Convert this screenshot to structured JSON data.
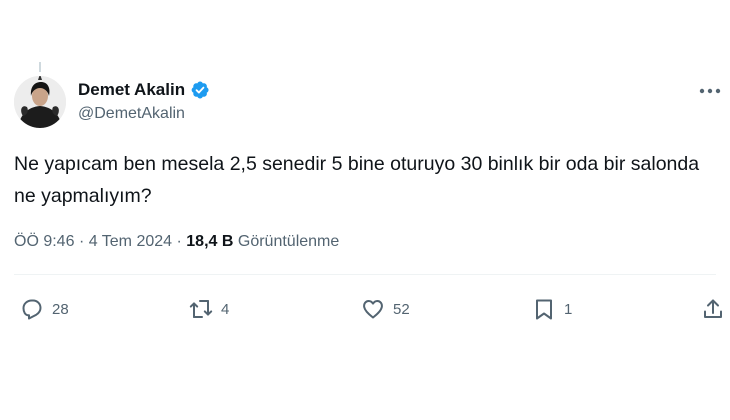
{
  "author": {
    "display_name": "Demet Akalin",
    "handle": "@DemetAkalin",
    "verified": true
  },
  "tweet": {
    "text": "Ne yapıcam ben mesela 2,5 senedir 5 bine oturuyo 30 binlık bir oda bir salonda ne yapmalıyım?",
    "time": "ÖÖ 9:46",
    "date": "4 Tem 2024",
    "views_count": "18,4 B",
    "views_label": "Görüntülenme",
    "separator": "·"
  },
  "actions": {
    "replies": "28",
    "reposts": "4",
    "likes": "52",
    "bookmarks": "1"
  },
  "icons": {
    "verified": "verified-badge-icon",
    "more": "more-icon",
    "reply": "reply-icon",
    "repost": "repost-icon",
    "like": "heart-icon",
    "bookmark": "bookmark-icon",
    "share": "share-icon"
  },
  "colors": {
    "verified_blue": "#1d9bf0",
    "text_primary": "#0f1419",
    "text_secondary": "#536471",
    "divider": "#eff3f4"
  }
}
